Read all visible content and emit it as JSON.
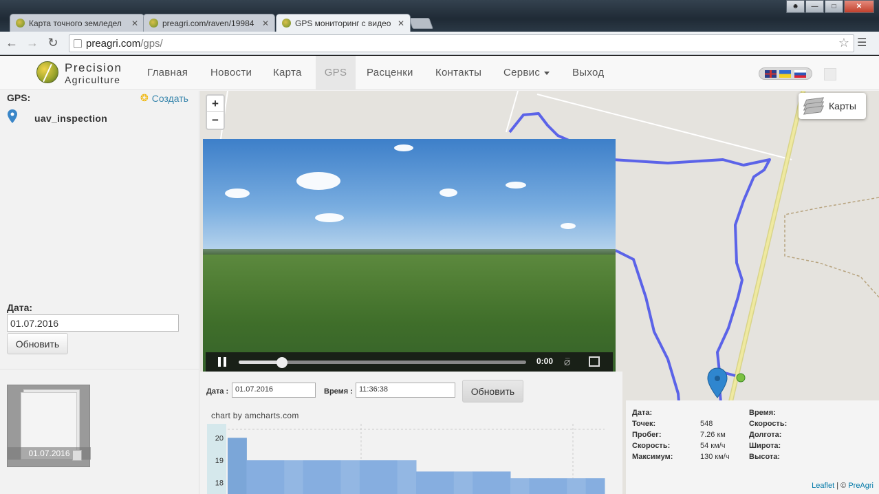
{
  "browser": {
    "tabs": [
      {
        "title": "Карта точного земледел",
        "active": false
      },
      {
        "title": "preagri.com/raven/19984",
        "active": false
      },
      {
        "title": "GPS мониторинг с видео",
        "active": true
      }
    ],
    "url_host": "preagri.com",
    "url_path": "/gps/"
  },
  "site": {
    "brand_line1": "Precision",
    "brand_line2": "Agriculture",
    "nav": [
      {
        "label": "Главная"
      },
      {
        "label": "Новости"
      },
      {
        "label": "Карта"
      },
      {
        "label": "GPS",
        "active": true
      },
      {
        "label": "Расценки"
      },
      {
        "label": "Контакты"
      },
      {
        "label": "Сервис"
      },
      {
        "label": "Выход"
      }
    ],
    "languages": [
      "en",
      "ua",
      "ru"
    ]
  },
  "sidebar": {
    "gps_label": "GPS:",
    "create_label": "Создать",
    "device_name": "uav_inspection",
    "date_label": "Дата:",
    "date_value": "01.07.2016",
    "refresh_label": "Обновить",
    "thumb_caption": "01.07.2016"
  },
  "map": {
    "zoom_in": "+",
    "zoom_out": "−",
    "layers_label": "Карты",
    "attrib_leaflet": "Leaflet",
    "attrib_sep": " | © ",
    "attrib_owner": "PreAgri",
    "track_color": "#5b63e8"
  },
  "video": {
    "time": "0:00",
    "progress": 0.15
  },
  "chart_panel": {
    "date_label": "Дата :",
    "date_value": "01.07.2016",
    "time_label": "Время :",
    "time_value": "11:36:38",
    "refresh_label": "Обновить",
    "credit": "chart by amcharts.com"
  },
  "chart_data": {
    "type": "bar",
    "ytick_labels": [
      "20",
      "19",
      "18"
    ],
    "ylim": [
      17.5,
      20.5
    ],
    "values": [
      20,
      19,
      19,
      19,
      19,
      19,
      19,
      19,
      19,
      19,
      18.5,
      18.5,
      18.5,
      18.5,
      18.5,
      18.2,
      18.2,
      18.2,
      18.2,
      18.2
    ],
    "xlabel": "",
    "ylabel": ""
  },
  "info": {
    "date_label": "Дата:",
    "points_label": "Точек:",
    "points_value": "548",
    "distance_label": "Пробег:",
    "distance_value": "7.26 км",
    "speed_label": "Скорость:",
    "speed_value": "54 км/ч",
    "max_label": "Максимум:",
    "max_value": "130 км/ч",
    "time_label": "Время:",
    "speed2_label": "Скорость:",
    "lon_label": "Долгота:",
    "lat_label": "Широта:",
    "alt_label": "Высота:"
  }
}
